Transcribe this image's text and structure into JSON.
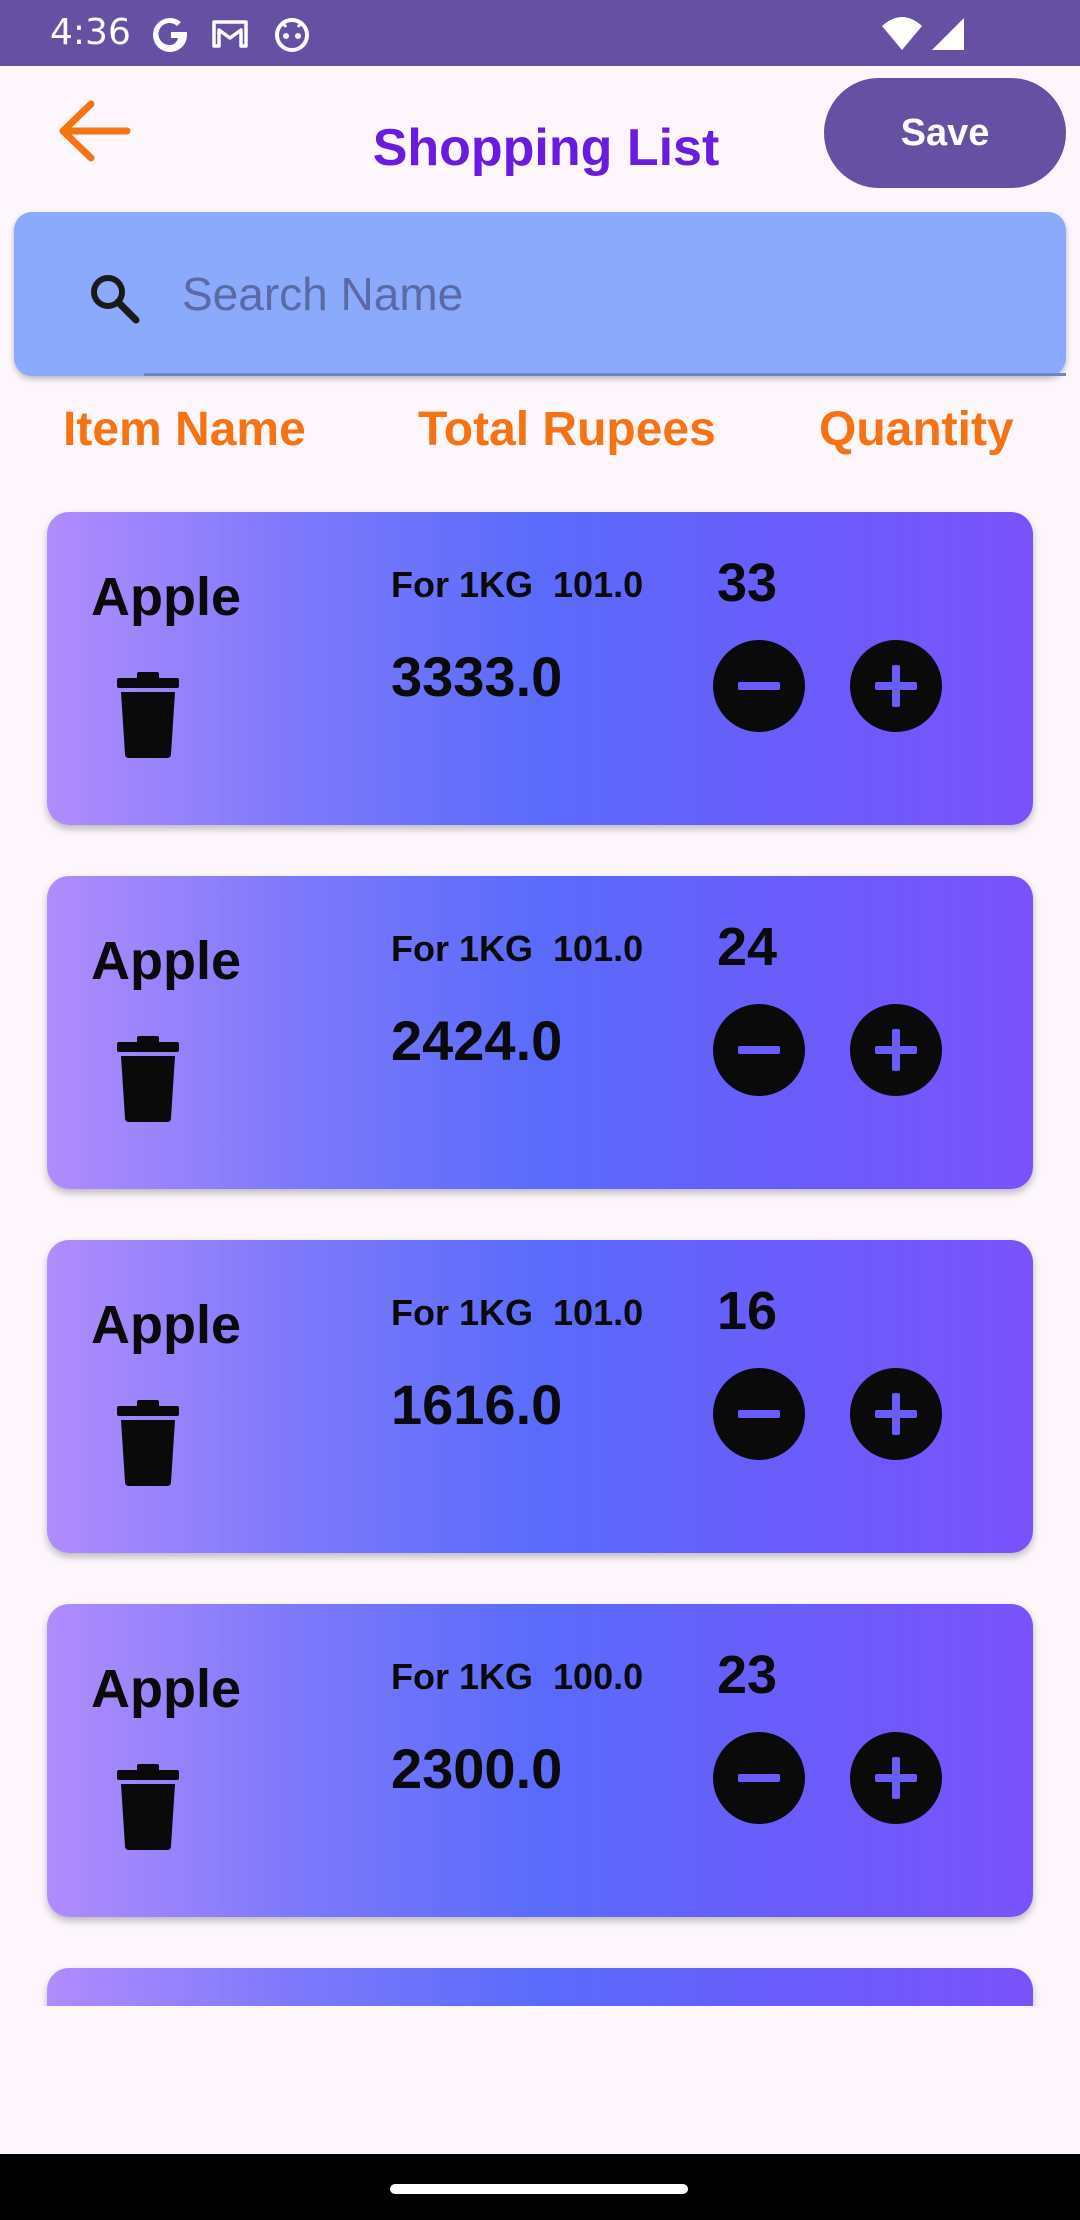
{
  "status_bar": {
    "time": "4:36",
    "left_icons": [
      "google-icon",
      "gmail-icon",
      "android-debug-icon"
    ],
    "right_icons": [
      "wifi-icon",
      "signal-icon"
    ]
  },
  "header": {
    "back_icon": "arrow-left-icon",
    "title": "Shopping List",
    "save_label": "Save"
  },
  "search": {
    "icon": "search-icon",
    "placeholder": "Search Name",
    "value": ""
  },
  "columns": {
    "item_name": "Item Name",
    "total_rupees": "Total Rupees",
    "quantity": "Quantity"
  },
  "items": [
    {
      "name": "Apple",
      "unit_label": "For 1KG",
      "unit_price": "101.0",
      "total": "3333.0",
      "quantity": "33"
    },
    {
      "name": "Apple",
      "unit_label": "For 1KG",
      "unit_price": "101.0",
      "total": "2424.0",
      "quantity": "24"
    },
    {
      "name": "Apple",
      "unit_label": "For 1KG",
      "unit_price": "101.0",
      "total": "1616.0",
      "quantity": "16"
    },
    {
      "name": "Apple",
      "unit_label": "For 1KG",
      "unit_price": "100.0",
      "total": "2300.0",
      "quantity": "23"
    }
  ],
  "colors": {
    "status_bar": "#6650A4",
    "title": "#6A1BE0",
    "accent_orange": "#F57313",
    "search_bg": "#8BAAFC",
    "card_gradient": [
      "#B08CFC",
      "#5A6BFB",
      "#7A52FC"
    ]
  }
}
